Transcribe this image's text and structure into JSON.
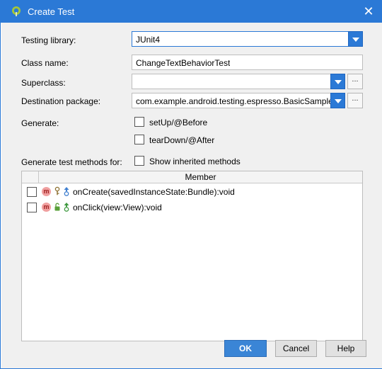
{
  "window": {
    "title": "Create Test",
    "close_glyph": "✕"
  },
  "form": {
    "testing_library": {
      "label": "Testing library:",
      "value": "JUnit4"
    },
    "class_name": {
      "label": "Class name:",
      "value": "ChangeTextBehaviorTest"
    },
    "superclass": {
      "label": "Superclass:",
      "value": ""
    },
    "destination_package": {
      "label": "Destination package:",
      "value": "com.example.android.testing.espresso.BasicSample"
    },
    "generate": {
      "label": "Generate:",
      "options": [
        {
          "label": "setUp/@Before",
          "checked": false
        },
        {
          "label": "tearDown/@After",
          "checked": false
        }
      ]
    },
    "generate_methods": {
      "label": "Generate test methods for:",
      "show_inherited_label": "Show inherited methods",
      "checked": false
    },
    "browse_label": "..."
  },
  "table": {
    "header": "Member",
    "rows": [
      {
        "badge": "m",
        "visibility": "protected",
        "signature": "onCreate(savedInstanceState:Bundle):void",
        "checked": false
      },
      {
        "badge": "m",
        "visibility": "public",
        "signature": "onClick(view:View):void",
        "checked": false
      }
    ]
  },
  "buttons": {
    "ok": "OK",
    "cancel": "Cancel",
    "help": "Help"
  },
  "colors": {
    "accent": "#2b79d6",
    "titlebar": "#2b79d6",
    "badge": "#f0a0a0"
  }
}
